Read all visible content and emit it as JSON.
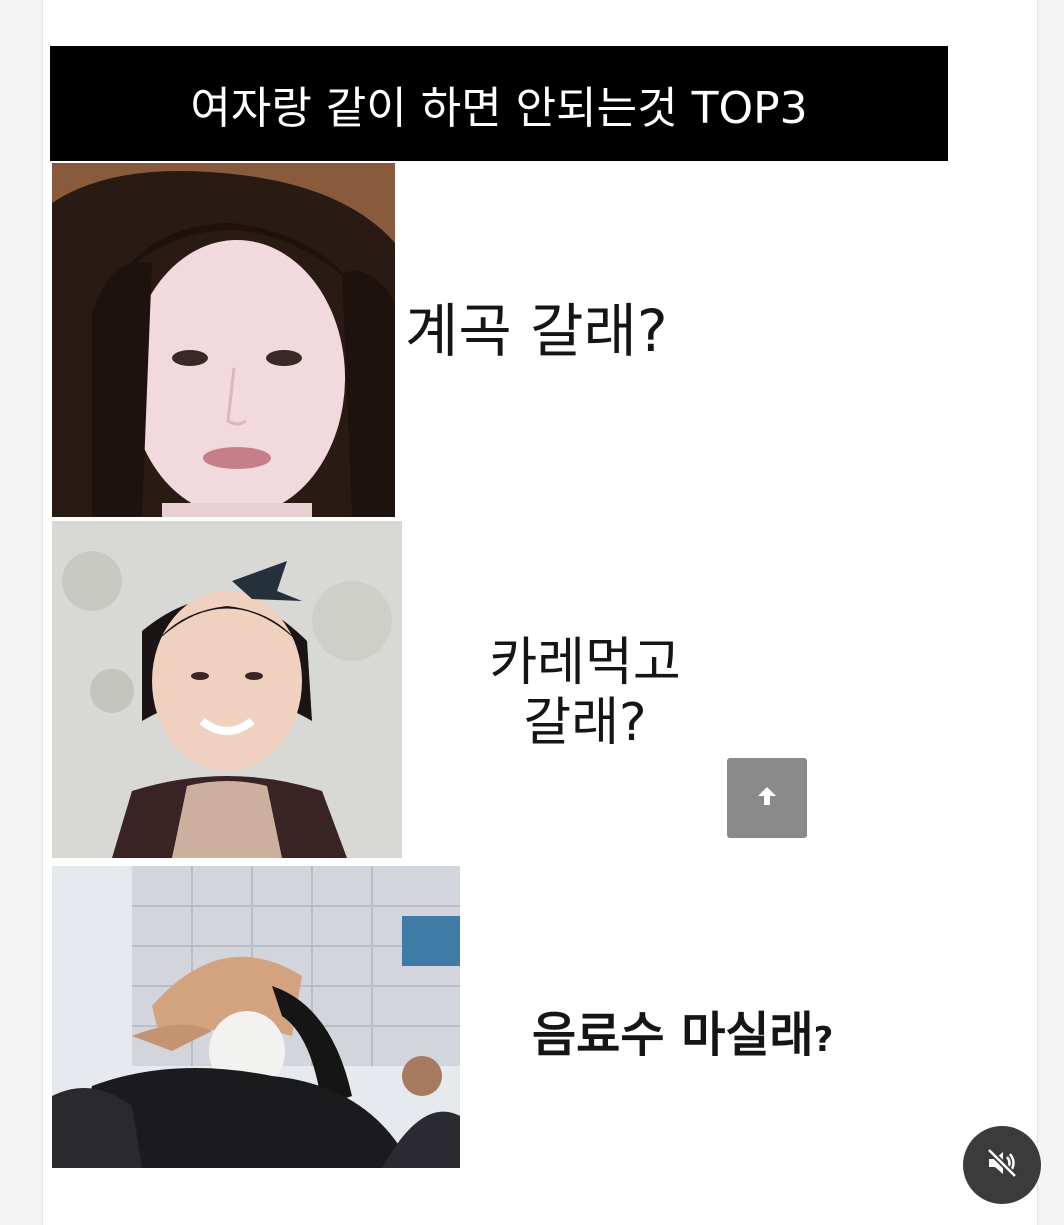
{
  "meme": {
    "title": "여자랑 같이 하면 안되는것 TOP3",
    "items": [
      {
        "caption": "계곡 갈래?"
      },
      {
        "caption_line1": "카레먹고",
        "caption_line2": "갈래?"
      },
      {
        "caption_main": "음료수 마실래",
        "caption_mark": "?"
      }
    ]
  },
  "controls": {
    "scroll_top_icon": "arrow-up-icon",
    "mute_icon": "speaker-muted-icon"
  },
  "colors": {
    "title_bar": "#000000",
    "title_text": "#ffffff",
    "scroll_button": "#8a8a8a",
    "mute_button": "#3b3b3b"
  }
}
